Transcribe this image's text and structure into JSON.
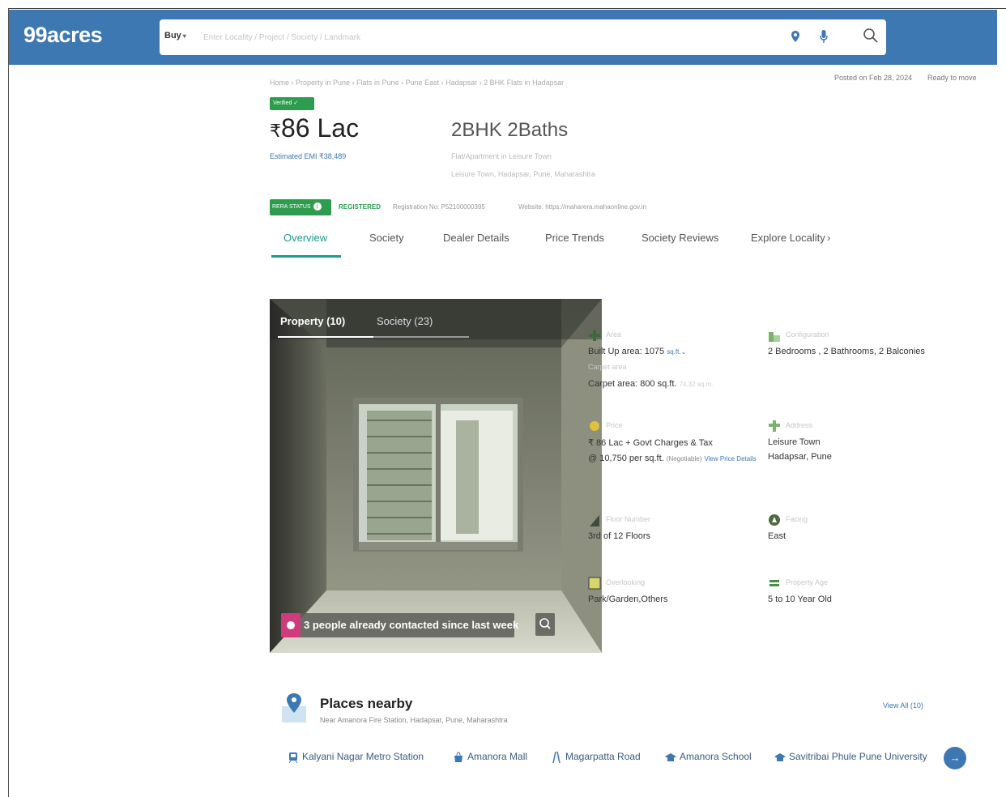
{
  "header": {
    "logo": "99acres",
    "buy_label": "Buy",
    "search_placeholder": "Enter Locality / Project / Society / Landmark"
  },
  "breadcrumb": "Home › Property in Pune › Flats in Pune › Pune East › Hadapsar › 2 BHK Flats in Hadapsar",
  "posted": "Posted on Feb 28, 2024",
  "status": "Ready to move",
  "verified_badge": "Verified",
  "price": {
    "symbol": "₹",
    "amount": "86 Lac",
    "emi": "Estimated EMI ₹38,489"
  },
  "config": {
    "title": "2BHK 2Baths",
    "sub1": "Flat/Apartment in Leisure Town",
    "sub2": "Leisure Town, Hadapsar, Pune, Maharashtra"
  },
  "rera": {
    "badge": "RERA STATUS",
    "registered": "REGISTERED",
    "reg_no": "Registration No: P52100000395",
    "website": "Website: https://maharera.mahaonline.gov.in"
  },
  "tabs": [
    "Overview",
    "Society",
    "Dealer Details",
    "Price Trends",
    "Society Reviews",
    "Explore Locality"
  ],
  "tab_arrow": "›",
  "photo": {
    "tab1": "Property (10)",
    "tab2": "Society (23)",
    "contacted": "3 people already contacted since last week"
  },
  "details": {
    "area": {
      "label": "Area",
      "built": "Built Up area: 1075",
      "unit": "sq.ft.",
      "carpet_label": "Carpet area",
      "carpet": "Carpet area: 800 sq.ft.",
      "carpet_sub": "74.32 sq.m."
    },
    "config": {
      "label": "Configuration",
      "value": "2 Bedrooms , 2 Bathrooms, 2 Balconies"
    },
    "price": {
      "label": "Price",
      "value": "₹ 86 Lac + Govt Charges & Tax",
      "per": "@ 10,750 per sq.ft.",
      "neg": "(Negotiable)",
      "link": "View Price Details"
    },
    "address": {
      "label": "Address",
      "line1": "Leisure Town",
      "line2": "Hadapsar, Pune"
    },
    "floor": {
      "label": "Floor Number",
      "value": "3rd of 12 Floors"
    },
    "facing": {
      "label": "Facing",
      "value": "East"
    },
    "overlooking": {
      "label": "Overlooking",
      "value": "Park/Garden,Others"
    },
    "age": {
      "label": "Property Age",
      "value": "5 to 10 Year Old"
    }
  },
  "places": {
    "title": "Places nearby",
    "subtitle": "Near Amanora Fire Station, Hadapsar, Pune, Maharashtra",
    "view_all": "View All (10)",
    "items": [
      "Kalyani Nagar Metro Station",
      "Amanora Mall",
      "Magarpatta Road",
      "Amanora School",
      "Savitribai Phule Pune University"
    ]
  },
  "colors": {
    "brand": "#3d78b3",
    "accent": "#1b9b8e",
    "green": "#2e9c4f"
  }
}
